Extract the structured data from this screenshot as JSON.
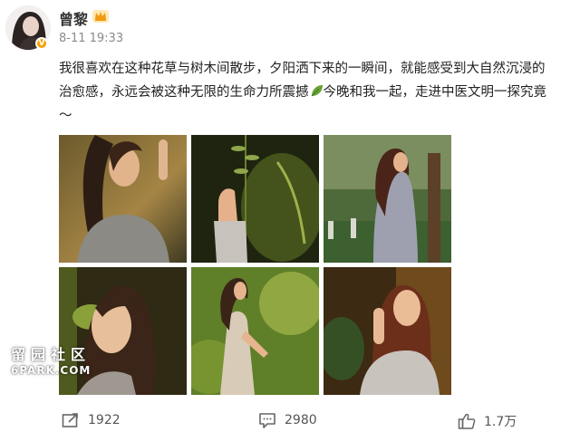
{
  "post": {
    "username": "曾黎",
    "badge_letter": "V",
    "timestamp": "8-11 19:33",
    "text_lines": [
      "我很喜欢在这种花草与树木间散步，夕阳洒下来的一瞬间，就能感受到大自然沉浸的",
      "治愈感，永远会被这种无限的生命力所震撼",
      "今晚和我一起，走进中医文明一探究竟",
      "～"
    ]
  },
  "watermark": {
    "cn": "留园社区",
    "en": "6PARK.COM"
  },
  "actions": {
    "repost_count": "1922",
    "comment_count": "2980",
    "like_count": "1.7万"
  },
  "icons": {
    "verified": "verified-v-icon",
    "member": "crown-icon",
    "leaf": "leaf-emoji-icon",
    "repost": "repost-icon",
    "comment": "comment-icon",
    "like": "thumbs-up-icon"
  },
  "colors": {
    "verified_badge": "#f7a100",
    "muted_text": "#8a8a8a"
  }
}
